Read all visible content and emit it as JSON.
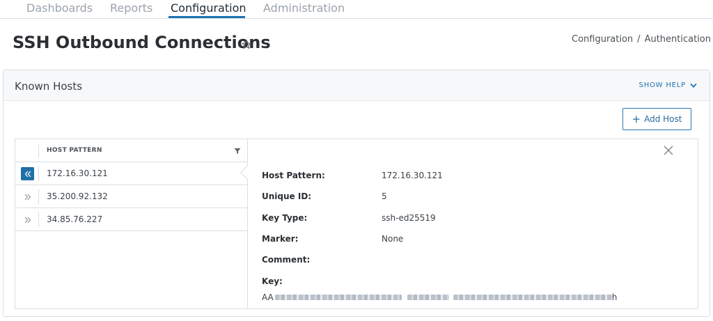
{
  "nav": {
    "tabs": [
      "Dashboards",
      "Reports",
      "Configuration",
      "Administration"
    ],
    "active": "Configuration"
  },
  "header": {
    "title": "SSH Outbound Connections",
    "breadcrumb": [
      "Configuration",
      "Authentication"
    ],
    "breadcrumb_separator": "/"
  },
  "panel": {
    "title": "Known Hosts",
    "show_help_label": "SHOW HELP",
    "add_host_label": "Add Host"
  },
  "list": {
    "column_header": "HOST PATTERN",
    "rows": [
      "172.16.30.121",
      "35.200.92.132",
      "34.85.76.227"
    ],
    "selected_row": "172.16.30.121"
  },
  "detail": {
    "fields": [
      {
        "label": "Host Pattern:",
        "value": "172.16.30.121"
      },
      {
        "label": "Unique ID:",
        "value": "5"
      },
      {
        "label": "Key Type:",
        "value": "ssh-ed25519"
      },
      {
        "label": "Marker:",
        "value": "None"
      },
      {
        "label": "Comment:",
        "value": ""
      },
      {
        "label": "Key:",
        "value": ""
      }
    ],
    "key_prefix": "AA",
    "key_suffix": "h"
  },
  "colors": {
    "accent": "#1b72b3",
    "active_expand": "#1f6fa8",
    "border": "#d9dde2"
  },
  "icons": {
    "favorite": "star-icon",
    "help_toggle": "chevron-down-icon",
    "filter": "filter-icon",
    "expand": "double-chevron-right-icon",
    "collapse": "double-chevron-left-icon",
    "close": "close-icon"
  }
}
